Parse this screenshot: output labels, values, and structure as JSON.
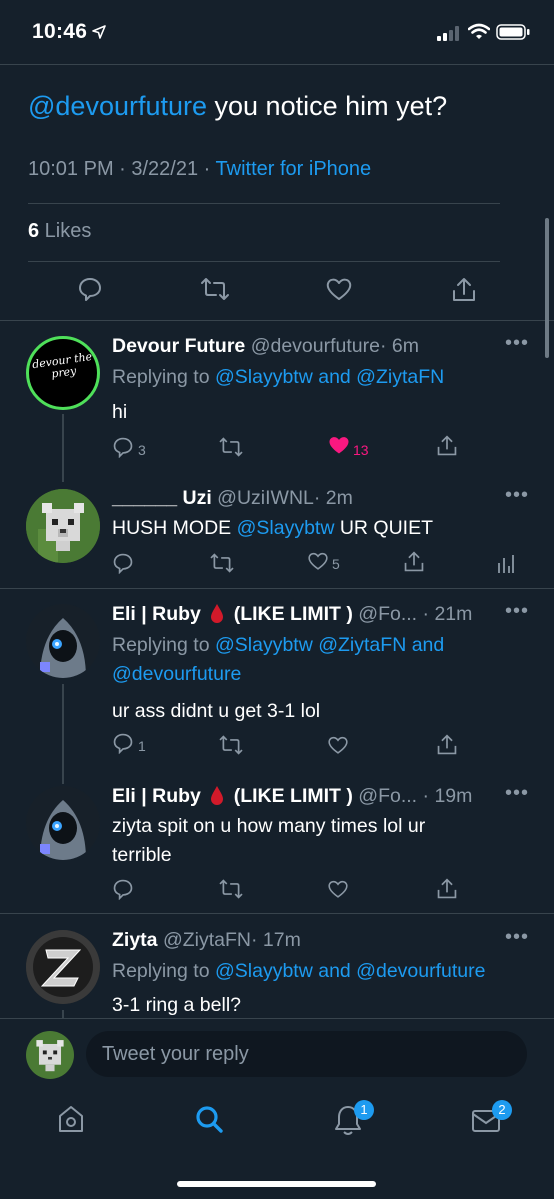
{
  "status": {
    "time": "10:46"
  },
  "tweet": {
    "mention": "@devourfuture",
    "text": " you notice him yet?",
    "time": "10:01 PM · 3/22/21 · ",
    "source": "Twitter for iPhone",
    "likes_count": "6",
    "likes_label": " Likes"
  },
  "replies": [
    {
      "name": "Devour Future",
      "handle": "@devourfuture",
      "time": "· 6m",
      "replying": "Replying to ",
      "replying_to": "@Slayybtw and @ZiytaFN",
      "text": "hi",
      "reply_count": "3",
      "like_count": "13",
      "avatar_text": "devour the prey"
    },
    {
      "name": "______ Uzi",
      "handle": "@UziIWNL",
      "time": "· 2m",
      "text_prefix": "HUSH MODE ",
      "text_mention": "@Slayybtw",
      "text_suffix": " UR QUIET",
      "like_count": "5"
    },
    {
      "name": "Eli | Ruby",
      "name_suffix": " (LIKE LIMIT )",
      "handle": "@Fo...",
      "time": "· 21m",
      "replying": "Replying to ",
      "replying_to_line1": "@Slayybtw @ZiytaFN and",
      "replying_to_line2": "@devourfuture",
      "text": "ur ass didnt u get 3-1 lol",
      "reply_count": "1"
    },
    {
      "name": "Eli | Ruby",
      "name_suffix": " (LIKE LIMIT )",
      "handle": "@Fo...",
      "time": "· 19m",
      "text_line1": "ziyta spit on u how many times lol ur",
      "text_line2": "terrible"
    },
    {
      "name": "Ziyta",
      "handle": "@ZiytaFN",
      "time": "· 17m",
      "replying": "Replying to ",
      "replying_to": "@Slayybtw and @devourfuture",
      "text": "3-1 ring a bell?"
    }
  ],
  "composer": {
    "placeholder": "Tweet your reply"
  },
  "tabs": {
    "notifications_badge": "1",
    "messages_badge": "2"
  },
  "colors": {
    "background": "#15202b",
    "accent": "#1d9bf0",
    "like": "#f91880",
    "muted": "#8b98a5"
  }
}
